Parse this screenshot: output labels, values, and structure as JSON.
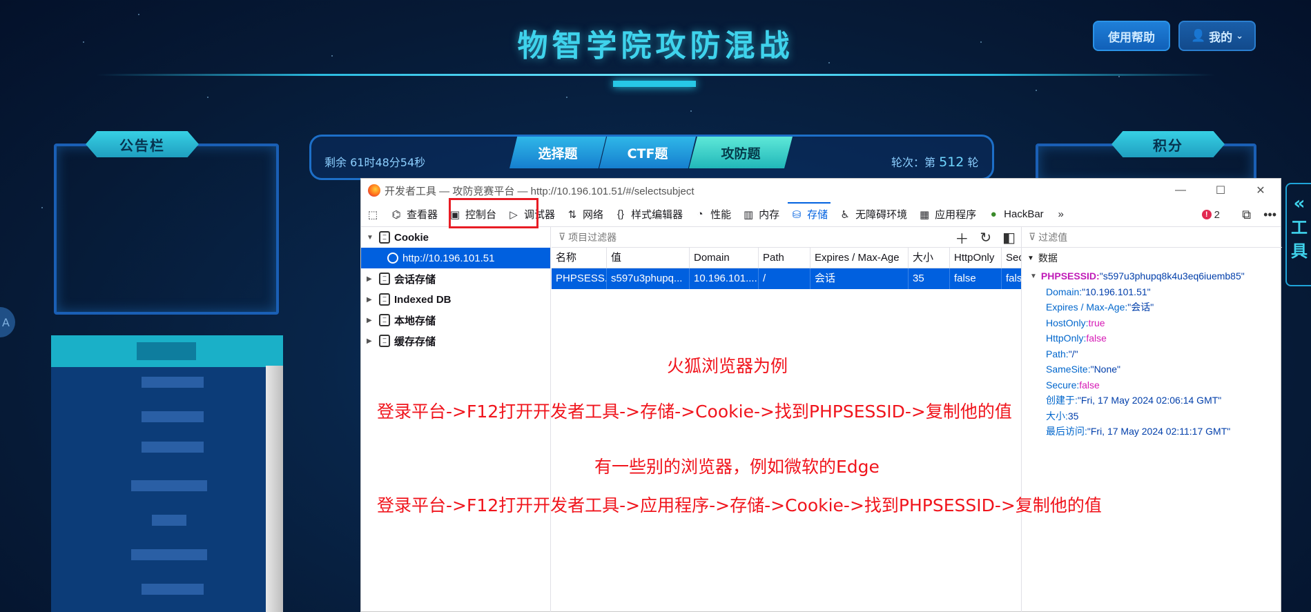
{
  "page": {
    "title": "物智学院攻防混战",
    "help_label": "使用帮助",
    "me_label": "我的"
  },
  "panels": {
    "left_title": "公告栏",
    "right_title": "积分"
  },
  "center": {
    "timer": "剩余 61时48分54秒",
    "tabs": [
      "选择题",
      "CTF题",
      "攻防题"
    ],
    "round_prefix": "轮次：第",
    "round_number": "512",
    "round_suffix": "轮"
  },
  "right_tool_label": "工具",
  "left_circle_label": "A",
  "devtools": {
    "window_title": "开发者工具 — 攻防竞赛平台 — http://10.196.101.51/#/selectsubject",
    "tools": [
      {
        "label": "查看器",
        "icon": "inspector-icon"
      },
      {
        "label": "控制台",
        "icon": "console-icon"
      },
      {
        "label": "调试器",
        "icon": "debugger-icon"
      },
      {
        "label": "网络",
        "icon": "network-icon"
      },
      {
        "label": "样式编辑器",
        "icon": "style-editor-icon"
      },
      {
        "label": "性能",
        "icon": "performance-icon"
      },
      {
        "label": "内存",
        "icon": "memory-icon"
      },
      {
        "label": "存储",
        "icon": "storage-icon"
      },
      {
        "label": "无障碍环境",
        "icon": "accessibility-icon"
      },
      {
        "label": "应用程序",
        "icon": "application-icon"
      },
      {
        "label": "HackBar",
        "icon": "hackbar-icon"
      }
    ],
    "error_count": "2",
    "tree": {
      "cookie": "Cookie",
      "cookie_host": "http://10.196.101.51",
      "session_storage": "会话存储",
      "indexed_db": "Indexed DB",
      "local_storage": "本地存储",
      "cache_storage": "缓存存储"
    },
    "filter_placeholder": "项目过滤器",
    "columns": [
      "名称",
      "值",
      "Domain",
      "Path",
      "Expires / Max-Age",
      "大小",
      "HttpOnly",
      "Secu"
    ],
    "row": [
      "PHPSESS...",
      "s597u3phupq...",
      "10.196.101....",
      "/",
      "会话",
      "35",
      "false",
      "fals"
    ],
    "side_filter_placeholder": "过滤值",
    "side_title": "数据",
    "cookie_name": "PHPSESSID",
    "cookie_value": "\"s597u3phupq8k4u3eq6iuemb85\"",
    "details": [
      {
        "k": "Domain:",
        "v": "\"10.196.101.51\"",
        "bool": false
      },
      {
        "k": "Expires / Max-Age:",
        "v": "\"会话\"",
        "bool": false
      },
      {
        "k": "HostOnly:",
        "v": "true",
        "bool": true
      },
      {
        "k": "HttpOnly:",
        "v": "false",
        "bool": true
      },
      {
        "k": "Path:",
        "v": "\"/\"",
        "bool": false
      },
      {
        "k": "SameSite:",
        "v": "\"None\"",
        "bool": false
      },
      {
        "k": "Secure:",
        "v": "false",
        "bool": true
      },
      {
        "k": "创建于:",
        "v": "\"Fri, 17 May 2024 02:06:14 GMT\"",
        "bool": false
      },
      {
        "k": "大小:",
        "v": "35",
        "bool": false
      },
      {
        "k": "最后访问:",
        "v": "\"Fri, 17 May 2024 02:11:17 GMT\"",
        "bool": false
      }
    ]
  },
  "annotations": {
    "a1": "火狐浏览器为例",
    "a2": "登录平台->F12打开开发者工具->存储->Cookie->找到PHPSESSID->复制他的值",
    "a3": "有一些别的浏览器，例如微软的Edge",
    "a4": "登录平台->F12打开开发者工具->应用程序->存储->Cookie->找到PHPSESSID->复制他的值"
  },
  "colors": {
    "accent_cyan": "#3fd3ec",
    "annotation_red": "#f0141c",
    "selection_blue": "#0060df"
  }
}
